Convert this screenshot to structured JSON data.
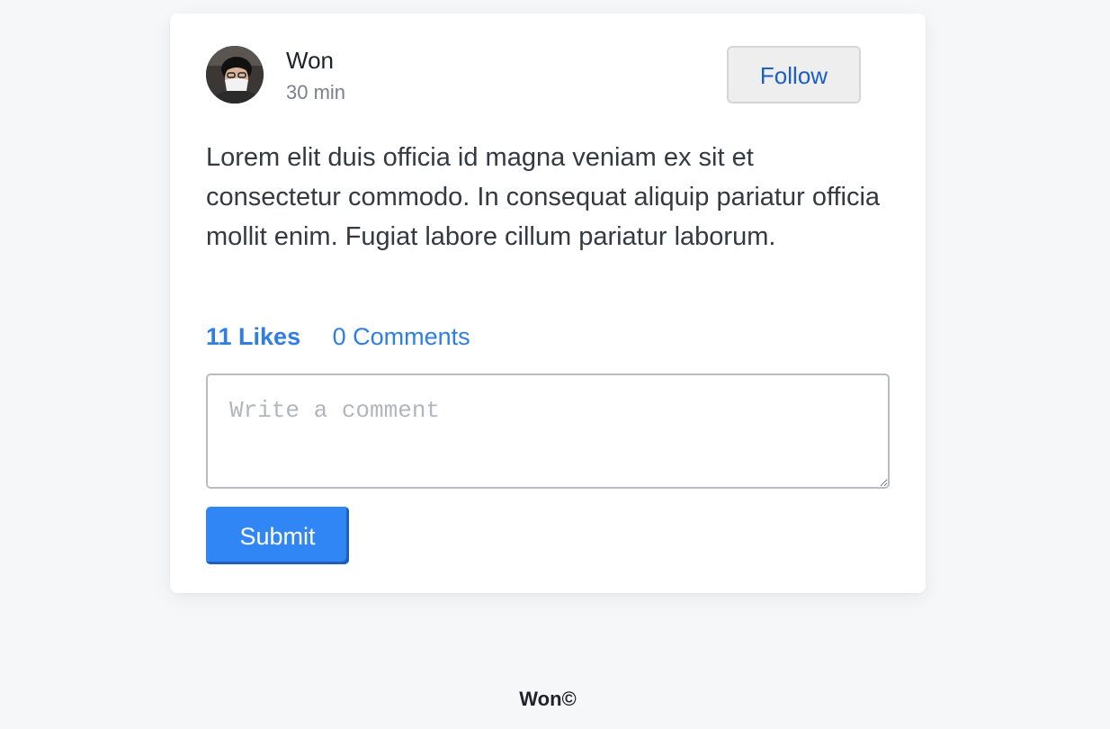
{
  "post": {
    "author": {
      "name": "Won",
      "avatar_icon": "user-photo-avatar"
    },
    "time": "30 min",
    "follow_label": "Follow",
    "body": "Lorem elit duis officia id magna veniam ex sit et consectetur commodo. In consequat aliquip pariatur officia mollit enim. Fugiat labore cillum pariatur laborum.",
    "likes_label": "11 Likes",
    "comments_label": "0 Comments",
    "comment_placeholder": "Write a comment",
    "comment_value": "",
    "submit_label": "Submit"
  },
  "footer": {
    "text": "Won©"
  },
  "colors": {
    "page_background": "#f6f7f9",
    "card_background": "#ffffff",
    "link": "#2f7ee8",
    "follow_text": "#1b5fc4",
    "submit_background": "#2f86f4"
  }
}
